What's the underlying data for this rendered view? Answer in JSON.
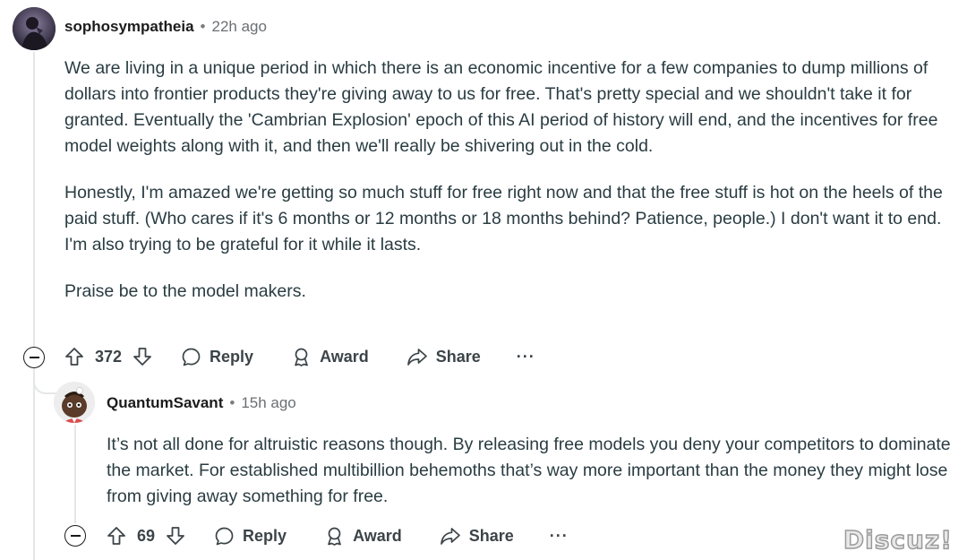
{
  "comments": [
    {
      "username": "sophosympatheia",
      "time": "22h ago",
      "paragraphs": [
        "We are living in a unique period in which there is an economic incentive for a few companies to dump millions of dollars into frontier products they're giving away to us for free. That's pretty special and we shouldn't take it for granted. Eventually the 'Cambrian Explosion' epoch of this AI period of history will end, and the incentives for free model weights along with it, and then we'll really be shivering out in the cold.",
        "Honestly, I'm amazed we're getting so much stuff for free right now and that the free stuff is hot on the heels of the paid stuff. (Who cares if it's 6 months or 12 months or 18 months behind? Patience, people.) I don't want it to end. I'm also trying to be grateful for it while it lasts.",
        "Praise be to the model makers."
      ],
      "votes": "372",
      "reply_label": "Reply",
      "award_label": "Award",
      "share_label": "Share",
      "more_label": "···"
    },
    {
      "username": "QuantumSavant",
      "time": "15h ago",
      "paragraphs": [
        "It’s not all done for altruistic reasons though. By releasing free models you deny your competitors to dominate the market. For established multibillion behemoths that’s way more important than the money they might lose from giving away something for free."
      ],
      "votes": "69",
      "reply_label": "Reply",
      "award_label": "Award",
      "share_label": "Share",
      "more_label": "···"
    }
  ],
  "separator": "•",
  "watermark": "Discuz!",
  "icons": [
    "upvote-icon",
    "downvote-icon",
    "comment-icon",
    "award-icon",
    "share-icon",
    "collapse-icon"
  ]
}
